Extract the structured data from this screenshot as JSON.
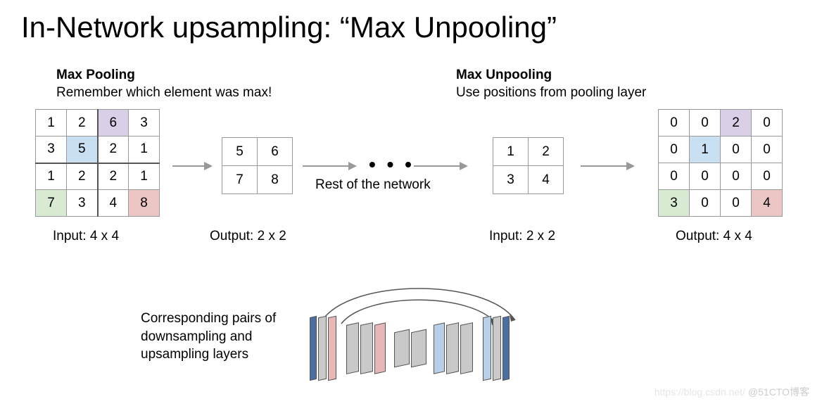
{
  "title": "In-Network upsampling: “Max Unpooling”",
  "maxpool": {
    "heading": "Max Pooling",
    "sub": "Remember which element was max!",
    "caption": "Input: 4 x 4",
    "grid": [
      [
        "1",
        "2",
        "6",
        "3"
      ],
      [
        "3",
        "5",
        "2",
        "1"
      ],
      [
        "1",
        "2",
        "2",
        "1"
      ],
      [
        "7",
        "3",
        "4",
        "8"
      ]
    ],
    "highlight": {
      "blue": [
        1,
        1
      ],
      "purple": [
        0,
        2
      ],
      "green": [
        3,
        0
      ],
      "pink": [
        3,
        3
      ]
    }
  },
  "output2x2": {
    "caption": "Output: 2 x 2",
    "grid": [
      [
        "5",
        "6"
      ],
      [
        "7",
        "8"
      ]
    ]
  },
  "rest_label": "Rest of the network",
  "dots": "• • •",
  "unpool_in": {
    "heading": "Max Unpooling",
    "sub": "Use positions from pooling layer",
    "caption": "Input: 2 x 2",
    "grid": [
      [
        "1",
        "2"
      ],
      [
        "3",
        "4"
      ]
    ]
  },
  "unpool_out": {
    "caption": "Output: 4 x 4",
    "grid": [
      [
        "0",
        "0",
        "2",
        "0"
      ],
      [
        "0",
        "1",
        "0",
        "0"
      ],
      [
        "0",
        "0",
        "0",
        "0"
      ],
      [
        "3",
        "0",
        "0",
        "4"
      ]
    ],
    "highlight": {
      "blue": [
        1,
        1
      ],
      "purple": [
        0,
        2
      ],
      "green": [
        3,
        0
      ],
      "pink": [
        3,
        3
      ]
    }
  },
  "corr_label": "Corresponding pairs of downsampling and upsampling layers",
  "watermark_faint": "https://blog.csdn.net/",
  "watermark": "@51CTO博客"
}
